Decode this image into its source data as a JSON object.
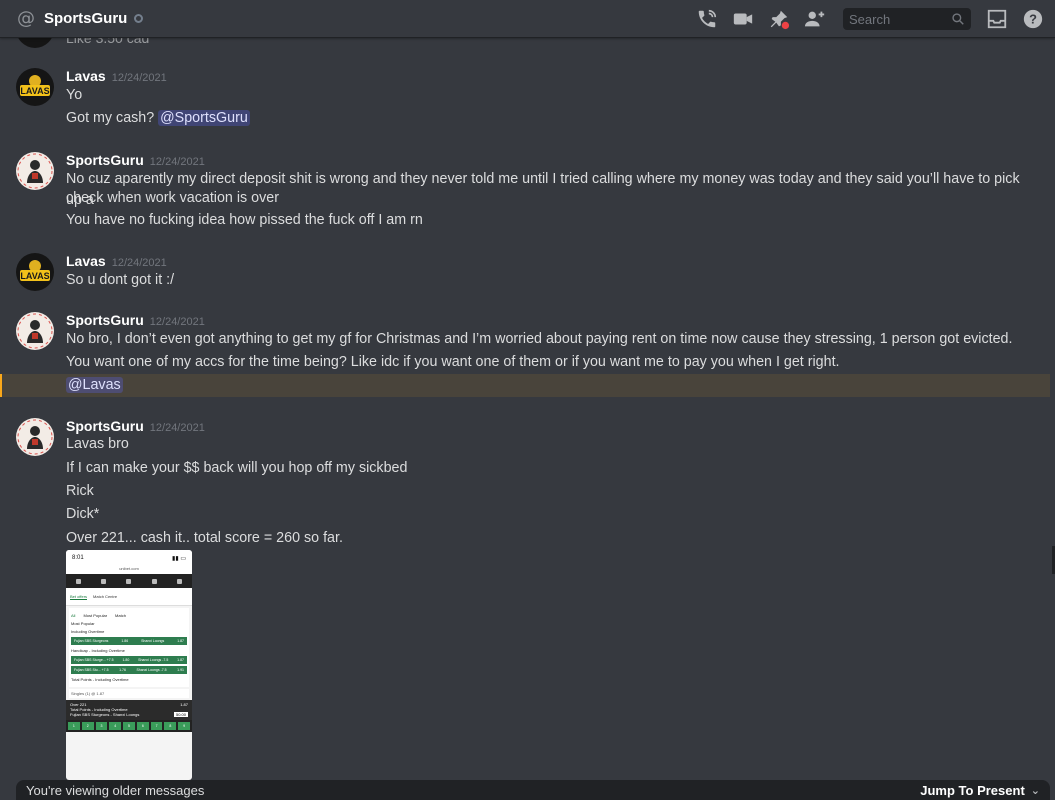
{
  "header": {
    "channel_name": "SportsGuru",
    "search": {
      "placeholder": "Search"
    }
  },
  "previous_snippet": "Like 3.50 cad",
  "messages": [
    {
      "author": "Lavas",
      "timestamp": "12/24/2021",
      "lines": [
        "Yo"
      ],
      "mention_line": {
        "text": "Got my cash? ",
        "mention": "@SportsGuru"
      }
    },
    {
      "author": "SportsGuru",
      "timestamp": "12/24/2021",
      "lines": [
        "No cuz aparently my direct deposit shit is wrong and they never told me until I tried calling where my money was today and they said you’ll have to pick up a",
        "check when work vacation is over",
        "You have no fucking idea how pissed the fuck off I am rn"
      ]
    },
    {
      "author": "Lavas",
      "timestamp": "12/24/2021",
      "lines": [
        "So u dont got it :/"
      ]
    },
    {
      "author": "SportsGuru",
      "timestamp": "12/24/2021",
      "lines": [
        "No bro, I don’t even got anything to get my gf for Christmas and I’m worried about paying rent on time now cause they stressing, 1 person got evicted.",
        "You want one of my accs for the time being? Like idc if you want one of them or if you want me to pay you when I get right."
      ],
      "mention": "@Lavas"
    },
    {
      "author": "SportsGuru",
      "timestamp": "12/24/2021",
      "lines": [
        "Lavas bro",
        "If I can make your $$ back will you hop off my sickbed",
        "Rick",
        "Dick*",
        "Over 221... cash it.. total score = 260 so far."
      ]
    }
  ],
  "attachment": {
    "time": "8:01",
    "url": "unibet.com",
    "tabs": [
      "Bet offers",
      "Match Centre"
    ],
    "subtabs": [
      "All",
      "Most Popular",
      "Match"
    ],
    "section_1": "Most Popular",
    "label_1": "Including Overtime",
    "row_1": [
      "Fujian SBS Sturgeons",
      "1.86",
      "Shanxi Loongs",
      "1.87"
    ],
    "section_2": "Handicap - Including Overtime",
    "row_2": [
      "Fujian SBS Sturge... +7.5",
      "1.80",
      "Shanxi Loongs -7.5",
      "1.87"
    ],
    "row_3": [
      "Fujian SBS Stu... +7.5",
      "1.76",
      "Shanxi Loongs -7.5",
      "1.91"
    ],
    "section_3": "Total Points - Including Overtime",
    "slip_header": "Singles (1) @ 1.87",
    "slip_pick": "Over 221",
    "slip_market": "Total Points - Including Overtime",
    "slip_match": "Fujian SBS Sturgeons - Shanxi Loongs",
    "slip_odds": "1.87",
    "slip_stake": "50.00",
    "keys": [
      "1",
      "2",
      "3",
      "4",
      "5",
      "6",
      "7",
      "8",
      "9"
    ]
  },
  "footer": {
    "older_text": "You're viewing older messages",
    "jump_label": "Jump To Present"
  }
}
